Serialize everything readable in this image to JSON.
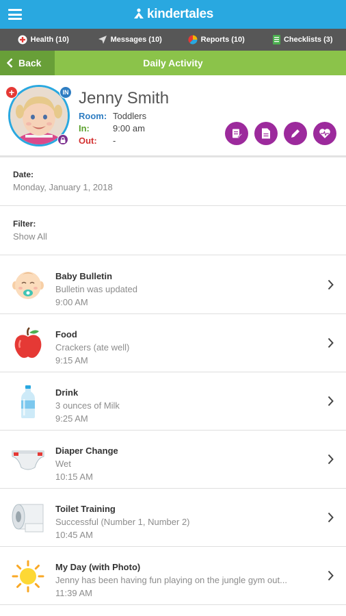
{
  "app": {
    "brand": "kindertales"
  },
  "tabs": [
    {
      "label": "Health (10)"
    },
    {
      "label": "Messages (10)"
    },
    {
      "label": "Reports (10)"
    },
    {
      "label": "Checklists (3)"
    }
  ],
  "nav": {
    "back_label": "Back",
    "title": "Daily Activity"
  },
  "child": {
    "name": "Jenny Smith",
    "room_label": "Room:",
    "room": "Toddlers",
    "in_label": "In:",
    "in_time": "9:00 am",
    "out_label": "Out:",
    "out_time": "-",
    "badge_in": "IN"
  },
  "date": {
    "label": "Date:",
    "value": "Monday, January 1, 2018"
  },
  "filter": {
    "label": "Filter:",
    "value": "Show All"
  },
  "activities": [
    {
      "icon": "baby-face-icon",
      "title": "Baby Bulletin",
      "detail": "Bulletin was updated",
      "time": "9:00 AM"
    },
    {
      "icon": "apple-icon",
      "title": "Food",
      "detail": "Crackers (ate well)",
      "time": "9:15 AM"
    },
    {
      "icon": "bottle-icon",
      "title": "Drink",
      "detail": "3 ounces of Milk",
      "time": "9:25 AM"
    },
    {
      "icon": "diaper-icon",
      "title": "Diaper Change",
      "detail": "Wet",
      "time": "10:15 AM"
    },
    {
      "icon": "toilet-paper-icon",
      "title": "Toilet Training",
      "detail": "Successful (Number 1, Number 2)",
      "time": "10:45 AM"
    },
    {
      "icon": "sun-icon",
      "title": "My Day (with Photo)",
      "detail": "Jenny has been having fun playing on the jungle gym out...",
      "time": "11:39 AM"
    }
  ],
  "colors": {
    "appbar": "#29a8e0",
    "tabbar": "#575757",
    "titlebar": "#8bc34a",
    "back": "#689f38",
    "action": "#9c2a9c"
  }
}
